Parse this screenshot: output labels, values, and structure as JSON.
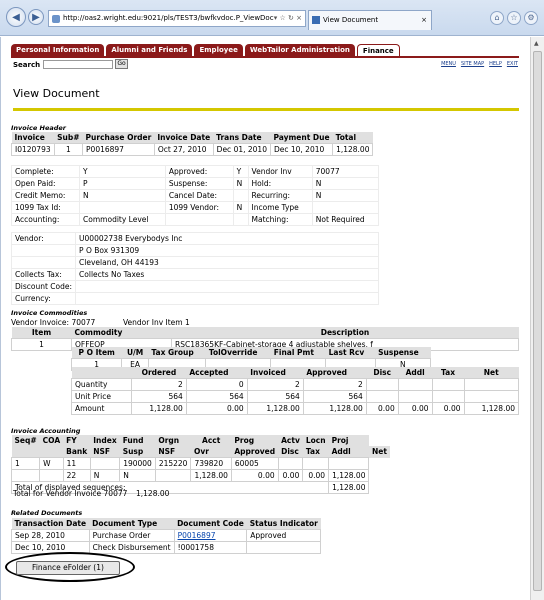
{
  "browser": {
    "url": "http://oas2.wright.edu:9021/pls/TEST3/bwfkvdoc.P_ViewDoc",
    "tab_title": "View Document",
    "close": "×"
  },
  "tabs": [
    "Personal Information",
    "Alumni and Friends",
    "Employee",
    "WebTailor Administration",
    "Finance"
  ],
  "search": {
    "label": "Search",
    "go": "Go"
  },
  "toplinks": [
    "MENU",
    "SITE MAP",
    "HELP",
    "EXIT"
  ],
  "title": "View Document",
  "invoice_header": {
    "section": "Invoice Header",
    "cols": [
      "Invoice",
      "Sub#",
      "Purchase Order",
      "Invoice Date",
      "Trans Date",
      "Payment Due",
      "Total"
    ],
    "row": [
      "I0120793",
      "1",
      "P0016897",
      "Oct 27, 2010",
      "Dec 01, 2010",
      "Dec 10, 2010",
      "1,128.00"
    ],
    "details": [
      [
        "Complete:",
        "Y",
        "Approved:",
        "Y",
        "Vendor Inv",
        "70077"
      ],
      [
        "Open Paid:",
        "P",
        "Suspense:",
        "N",
        "Hold:",
        "N"
      ],
      [
        "Credit Memo:",
        "N",
        "Cancel Date:",
        "",
        "Recurring:",
        "N"
      ],
      [
        "1099 Tax Id:",
        "",
        "1099 Vendor:",
        "N",
        "Income Type",
        ""
      ],
      [
        "Accounting:",
        "Commodity Level",
        "",
        "",
        "Matching:",
        "Not Required"
      ]
    ],
    "vendor": [
      [
        "Vendor:",
        "U00002738 Everybodys Inc"
      ],
      [
        "",
        "P O Box 931309"
      ],
      [
        "",
        "Cleveland, OH 44193"
      ],
      [
        "Collects Tax:",
        "Collects No Taxes"
      ],
      [
        "Discount Code:",
        ""
      ],
      [
        "Currency:",
        ""
      ]
    ]
  },
  "commodities": {
    "section": "Invoice Commodities",
    "vendor_invoice": "Vendor Invoice: 70077",
    "vendor_item": "Vendor Inv Item 1",
    "h1": [
      "Item",
      "Commodity",
      "Description"
    ],
    "r1": [
      "1",
      "OFFEQP",
      "RSC18365KF-Cabinet-storage 4 adjustable shelves, f"
    ],
    "h2": [
      "P O Item",
      "U/M",
      "Tax Group",
      "TolOverride",
      "Final Pmt",
      "Last Rcv",
      "Suspense"
    ],
    "r2": [
      "1",
      "EA",
      "",
      "",
      "",
      "",
      "N"
    ],
    "h3": [
      "Ordered",
      "Accepted",
      "Invoiced",
      "Approved",
      "Disc",
      "Addl",
      "Tax",
      "Net"
    ],
    "rows": [
      [
        "Quantity",
        "2",
        "0",
        "2",
        "2",
        "",
        "",
        "",
        ""
      ],
      [
        "Unit Price",
        "564",
        "564",
        "564",
        "564",
        "",
        "",
        "",
        ""
      ],
      [
        "Amount",
        "1,128.00",
        "0.00",
        "1,128.00",
        "1,128.00",
        "0.00",
        "0.00",
        "0.00",
        "1,128.00"
      ]
    ]
  },
  "accounting": {
    "section": "Invoice Accounting",
    "h1": [
      "Seq#",
      "COA",
      "FY",
      "Index",
      "Fund",
      "Orgn",
      "Acct",
      "Prog",
      "Actv",
      "Locn",
      "Proj"
    ],
    "h2": [
      "Bank",
      "NSF",
      "Susp",
      "NSF",
      "Ovr",
      "Approved",
      "Disc",
      "Tax",
      "Addl",
      "Net"
    ],
    "r1": [
      "1",
      "W",
      "11",
      "",
      "190000",
      "215220",
      "739820",
      "60005",
      "",
      "",
      ""
    ],
    "r2": [
      "22",
      "N",
      "N",
      "",
      "1,128.00",
      "0.00",
      "0.00",
      "0.00",
      "1,128.00"
    ],
    "total_label": "Total of displayed sequences:",
    "total_value": "1,128.00",
    "vendor_total_label": "Total for Vendor Invoice 70077",
    "vendor_total_value": "1,128.00"
  },
  "related": {
    "section": "Related Documents",
    "cols": [
      "Transaction Date",
      "Document Type",
      "Document Code",
      "Status Indicator"
    ],
    "rows": [
      [
        "Sep 28, 2010",
        "Purchase Order",
        "P0016897",
        "Approved"
      ],
      [
        "Dec 10, 2010",
        "Check Disbursement",
        "!0001758",
        ""
      ]
    ]
  },
  "efolder": "Finance eFolder (1)"
}
